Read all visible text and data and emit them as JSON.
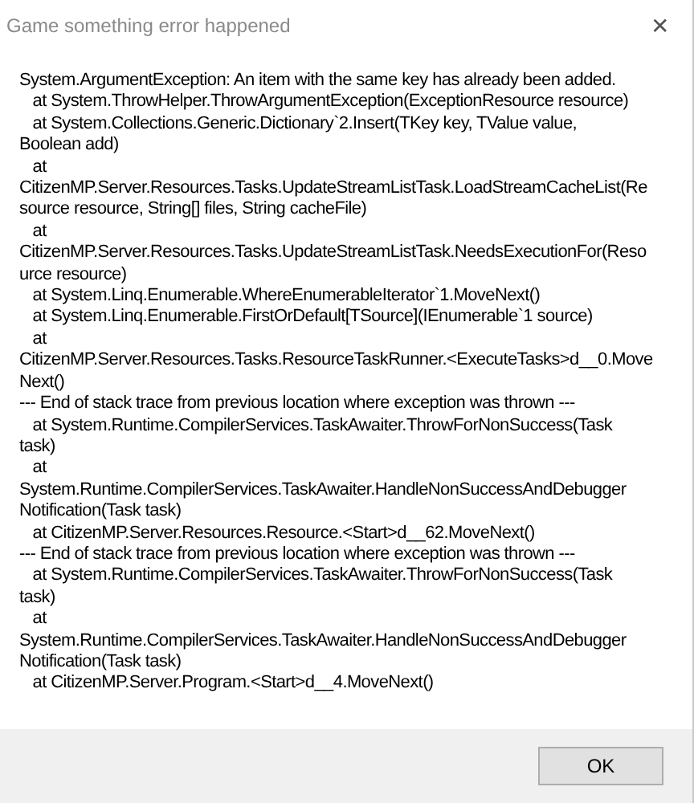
{
  "window": {
    "title": "Game something error happened",
    "close": "✕"
  },
  "message": [
    "System.ArgumentException: An item with the same key has already been added.",
    "   at System.ThrowHelper.ThrowArgumentException(ExceptionResource resource)",
    "   at System.Collections.Generic.Dictionary`2.Insert(TKey key, TValue value,",
    "Boolean add)",
    "   at",
    "CitizenMP.Server.Resources.Tasks.UpdateStreamListTask.LoadStreamCacheList(Re",
    "source resource, String[] files, String cacheFile)",
    "   at",
    "CitizenMP.Server.Resources.Tasks.UpdateStreamListTask.NeedsExecutionFor(Reso",
    "urce resource)",
    "   at System.Linq.Enumerable.WhereEnumerableIterator`1.MoveNext()",
    "   at System.Linq.Enumerable.FirstOrDefault[TSource](IEnumerable`1 source)",
    "   at",
    "CitizenMP.Server.Resources.Tasks.ResourceTaskRunner.<ExecuteTasks>d__0.Move",
    "Next()",
    "--- End of stack trace from previous location where exception was thrown ---",
    "   at System.Runtime.CompilerServices.TaskAwaiter.ThrowForNonSuccess(Task",
    "task)",
    "   at",
    "System.Runtime.CompilerServices.TaskAwaiter.HandleNonSuccessAndDebugger",
    "Notification(Task task)",
    "   at CitizenMP.Server.Resources.Resource.<Start>d__62.MoveNext()",
    "--- End of stack trace from previous location where exception was thrown ---",
    "   at System.Runtime.CompilerServices.TaskAwaiter.ThrowForNonSuccess(Task",
    "task)",
    "   at",
    "System.Runtime.CompilerServices.TaskAwaiter.HandleNonSuccessAndDebugger",
    "Notification(Task task)",
    "   at CitizenMP.Server.Program.<Start>d__4.MoveNext()"
  ],
  "buttons": [
    {
      "label": "OK"
    }
  ]
}
